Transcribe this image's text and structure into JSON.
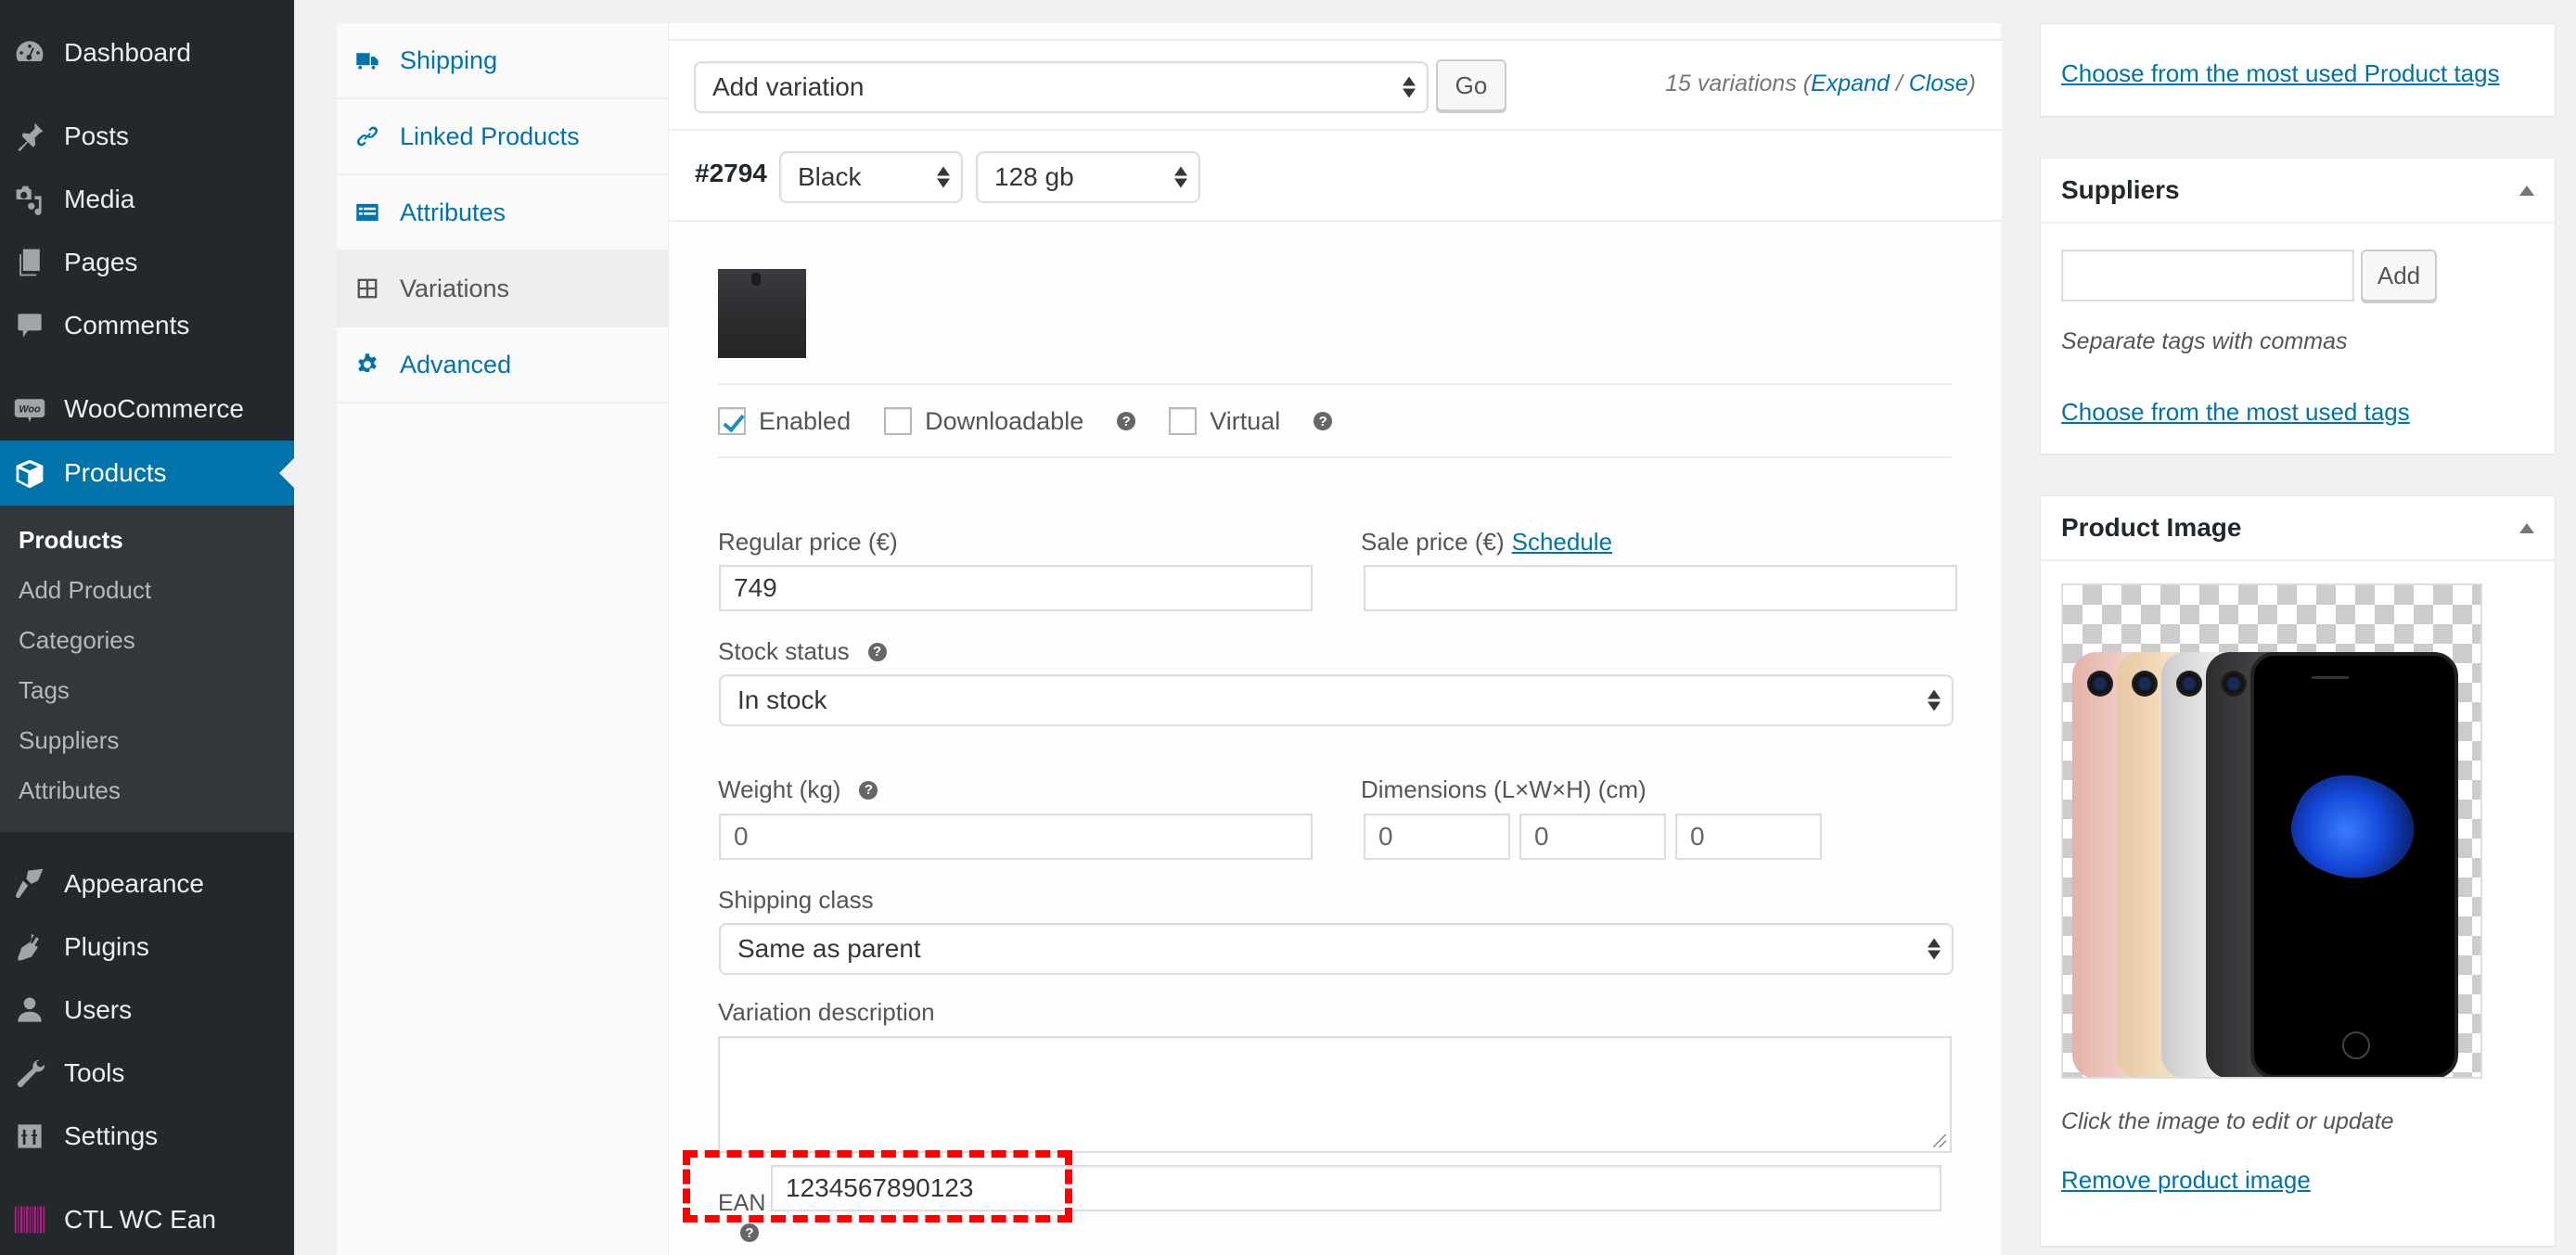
{
  "admin_menu": {
    "items": [
      {
        "label": "Dashboard",
        "icon": "dashboard-icon"
      },
      {
        "label": "Posts",
        "icon": "pushpin-icon"
      },
      {
        "label": "Media",
        "icon": "media-icon"
      },
      {
        "label": "Pages",
        "icon": "pages-icon"
      },
      {
        "label": "Comments",
        "icon": "comment-icon"
      },
      {
        "label": "WooCommerce",
        "icon": "woo-icon"
      },
      {
        "label": "Products",
        "icon": "box-icon",
        "current": true
      },
      {
        "label": "Appearance",
        "icon": "paintbrush-icon"
      },
      {
        "label": "Plugins",
        "icon": "plug-icon"
      },
      {
        "label": "Users",
        "icon": "user-icon"
      },
      {
        "label": "Tools",
        "icon": "wrench-icon"
      },
      {
        "label": "Settings",
        "icon": "sliders-icon"
      },
      {
        "label": "CTL WC Ean",
        "icon": "barcode-icon"
      }
    ],
    "submenu": [
      {
        "label": "Products",
        "current": true
      },
      {
        "label": "Add Product"
      },
      {
        "label": "Categories"
      },
      {
        "label": "Tags"
      },
      {
        "label": "Suppliers"
      },
      {
        "label": "Attributes"
      }
    ]
  },
  "product_tabs": [
    {
      "label": "Shipping",
      "icon": "truck-icon"
    },
    {
      "label": "Linked Products",
      "icon": "link-icon"
    },
    {
      "label": "Attributes",
      "icon": "list-icon"
    },
    {
      "label": "Variations",
      "icon": "grid-icon",
      "active": true
    },
    {
      "label": "Advanced",
      "icon": "gear-icon"
    }
  ],
  "variations": {
    "add_select": "Add variation",
    "go_label": "Go",
    "count_text": "15 variations (",
    "expand_label": "Expand",
    "separator": " / ",
    "close_label": "Close",
    "count_end": ")",
    "variation": {
      "id": "#2794",
      "color": "Black",
      "storage": "128 gb",
      "enabled_label": "Enabled",
      "enabled": true,
      "downloadable_label": "Downloadable",
      "downloadable": false,
      "virtual_label": "Virtual",
      "virtual": false,
      "help_glyph": "?",
      "regular_price_label": "Regular price (€)",
      "regular_price": "749",
      "sale_price_label": "Sale price (€)",
      "schedule_label": "Schedule",
      "sale_price": "",
      "stock_status_label": "Stock status",
      "stock_status": "In stock",
      "weight_label": "Weight (kg)",
      "weight_placeholder": "0",
      "dimensions_label": "Dimensions (L×W×H) (cm)",
      "length_placeholder": "0",
      "width_placeholder": "0",
      "height_placeholder": "0",
      "shipping_class_label": "Shipping class",
      "shipping_class": "Same as parent",
      "description_label": "Variation description",
      "description": "",
      "ean_label": "EAN",
      "ean_value": "1234567890123"
    }
  },
  "side": {
    "tags_box": {
      "most_used_link": "Choose from the most used Product tags"
    },
    "suppliers_box": {
      "title": "Suppliers",
      "input_value": "",
      "add_label": "Add",
      "hint": "Separate tags with commas",
      "most_used_link": "Choose from the most used tags"
    },
    "image_box": {
      "title": "Product Image",
      "hint": "Click the image to edit or update",
      "remove_link": "Remove product image"
    }
  },
  "colors": {
    "accent": "#0073aa",
    "sidebar_bg": "#23282d",
    "submenu_bg": "#32373c",
    "highlight": "#ff0000"
  }
}
